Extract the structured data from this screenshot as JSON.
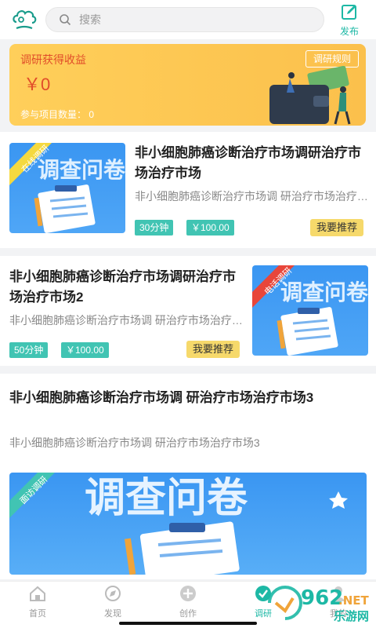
{
  "header": {
    "search_placeholder": "搜索",
    "publish_label": "发布"
  },
  "banner": {
    "title": "调研获得收益",
    "amount": "￥0",
    "count_text": "参与项目数量： 0",
    "rule_label": "调研规则"
  },
  "cards": [
    {
      "badge": "在线调研",
      "title": "非小细胞肺癌诊断治疗市场调研治疗市场治疗市场",
      "desc": "非小细胞肺癌诊断治疗市场调 研治疗市场治疗市场",
      "duration": "30分钟",
      "price": "￥100.00",
      "recommend": "我要推荐"
    },
    {
      "badge": "电话调研",
      "title": "非小细胞肺癌诊断治疗市场调研治疗市场治疗市场2",
      "desc": "非小细胞肺癌诊断治疗市场调 研治疗市场治疗市场2",
      "duration": "50分钟",
      "price": "￥100.00",
      "recommend": "我要推荐"
    },
    {
      "badge": "面访调研",
      "title": "非小细胞肺癌诊断治疗市场调 研治疗市场治疗市场3",
      "desc": "非小细胞肺癌诊断治疗市场调 研治疗市场治疗市场3"
    }
  ],
  "thumb_text": "调查问卷",
  "tabbar": [
    {
      "label": "首页",
      "icon": "home-icon"
    },
    {
      "label": "发现",
      "icon": "compass-icon"
    },
    {
      "label": "创作",
      "icon": "plus-circle-icon"
    },
    {
      "label": "调研",
      "icon": "check-circle-icon",
      "active": true
    },
    {
      "label": "我的",
      "icon": "user-icon"
    }
  ],
  "watermark": {
    "brand": "962",
    "suffix": ".NET",
    "sub": "乐游网"
  },
  "colors": {
    "accent": "#1db8a5",
    "banner": "#fbc04c",
    "tag": "#41c4b3",
    "recommend": "#f6d96b",
    "thumb": "#3a96f2"
  }
}
